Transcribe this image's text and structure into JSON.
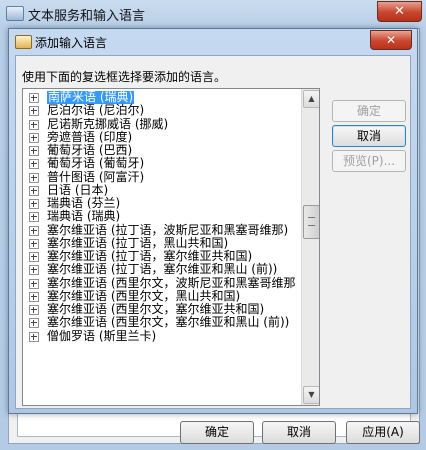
{
  "outer_window": {
    "title": "文本服务和输入语言",
    "close_glyph": "✕",
    "ok_label": "确定",
    "cancel_label": "取消",
    "apply_label": "应用(A)"
  },
  "dialog": {
    "title": "添加输入语言",
    "close_glyph": "✕",
    "instruction": "使用下面的复选框选择要添加的语言。",
    "buttons": {
      "ok": "确定",
      "cancel": "取消",
      "preview": "预览(P)..."
    }
  },
  "language_list": {
    "items": [
      {
        "label": "南萨米语 (瑞典)",
        "selected": true
      },
      {
        "label": "尼泊尔语 (尼泊尔)"
      },
      {
        "label": "尼诺斯克挪威语 (挪威)"
      },
      {
        "label": "旁遮普语 (印度)"
      },
      {
        "label": "葡萄牙语 (巴西)"
      },
      {
        "label": "葡萄牙语 (葡萄牙)"
      },
      {
        "label": "普什图语 (阿富汗)"
      },
      {
        "label": "日语 (日本)"
      },
      {
        "label": "瑞典语 (芬兰)"
      },
      {
        "label": "瑞典语 (瑞典)"
      },
      {
        "label": "塞尔维亚语 (拉丁语，波斯尼亚和黑塞哥维那)"
      },
      {
        "label": "塞尔维亚语 (拉丁语，黑山共和国)"
      },
      {
        "label": "塞尔维亚语 (拉丁语，塞尔维亚共和国)"
      },
      {
        "label": "塞尔维亚语 (拉丁语，塞尔维亚和黑山 (前))"
      },
      {
        "label": "塞尔维亚语 (西里尔文，波斯尼亚和黑塞哥维那"
      },
      {
        "label": "塞尔维亚语 (西里尔文，黑山共和国)"
      },
      {
        "label": "塞尔维亚语 (西里尔文，塞尔维亚共和国)"
      },
      {
        "label": "塞尔维亚语 (西里尔文，塞尔维亚和黑山 (前))"
      },
      {
        "label": "僧伽罗语 (斯里兰卡)"
      }
    ],
    "scroll_up_glyph": "▲",
    "scroll_down_glyph": "▼"
  }
}
